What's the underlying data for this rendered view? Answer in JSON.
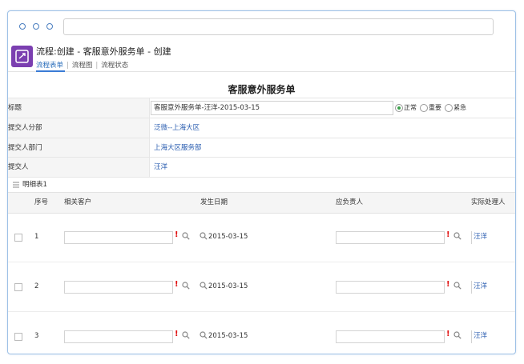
{
  "app": {
    "title": "流程:创建 - 客服意外服务单 - 创建",
    "icon": "process-icon",
    "accent": "#7b3fb0"
  },
  "tabs": [
    {
      "label": "流程表单",
      "active": true
    },
    {
      "label": "流程图",
      "active": false
    },
    {
      "label": "流程状态",
      "active": false
    }
  ],
  "form": {
    "title": "客服意外服务单",
    "fields": {
      "title_label": "标题",
      "title_value": "客服意外服务单-汪洋-2015-03-15",
      "priority_options": [
        "正常",
        "重要",
        "紧急"
      ],
      "priority_selected": "正常",
      "branch_label": "提交人分部",
      "branch_value": "泛微--上海大区",
      "dept_label": "提交人部门",
      "dept_value": "上海大区服务部",
      "submitter_label": "提交人",
      "submitter_value": "汪洋"
    }
  },
  "detail": {
    "header": "明细表1",
    "columns": [
      "序号",
      "相关客户",
      "发生日期",
      "应负责人",
      "实际处理人"
    ],
    "rows": [
      {
        "seq": "1",
        "date": "2015-03-15",
        "handler": "汪洋"
      },
      {
        "seq": "2",
        "date": "2015-03-15",
        "handler": "汪洋"
      },
      {
        "seq": "3",
        "date": "2015-03-15",
        "handler": "汪洋"
      }
    ]
  }
}
